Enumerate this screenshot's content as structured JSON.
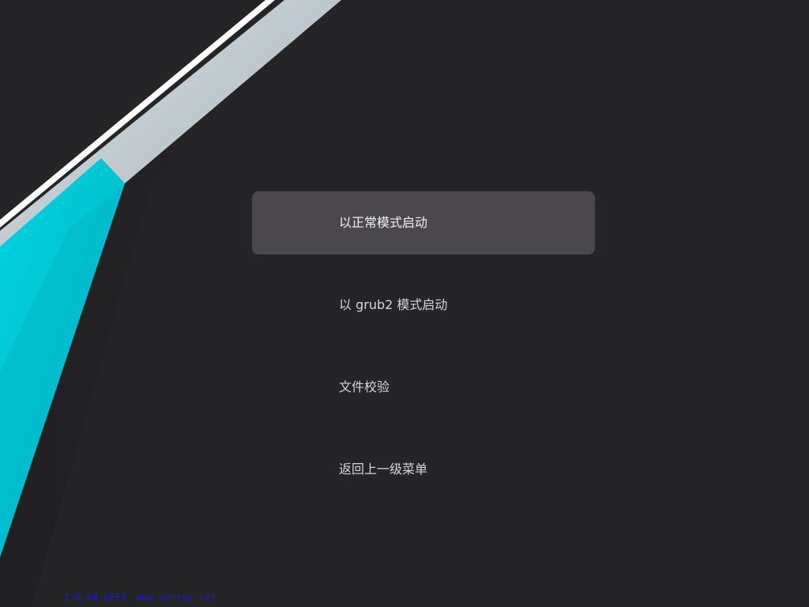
{
  "menu": {
    "items": [
      {
        "label": "以正常模式启动",
        "selected": true
      },
      {
        "label": "以 grub2 模式启动",
        "selected": false
      },
      {
        "label": "文件校验",
        "selected": false
      },
      {
        "label": "返回上一级菜单",
        "selected": false
      }
    ]
  },
  "footer": {
    "version": "1.0.60 UEFI",
    "website": "www.ventoy.net"
  },
  "colors": {
    "background": "#252427",
    "selection": "#4a484c",
    "accent_cyan": "#00c8d8",
    "accent_silver": "#b7c3ca",
    "footer_text": "#1d1dd0"
  }
}
